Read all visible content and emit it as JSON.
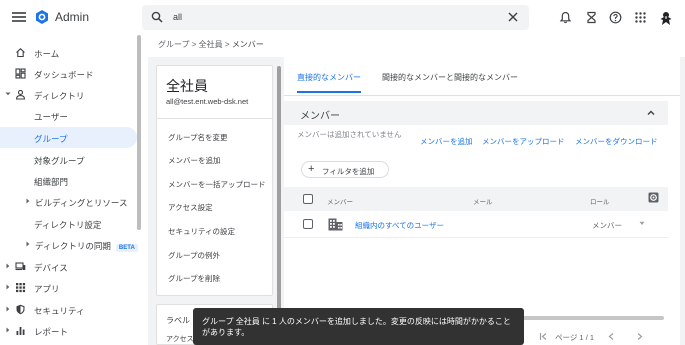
{
  "app": {
    "title": "Admin"
  },
  "search": {
    "value": "all"
  },
  "topbar": {
    "icons": [
      "notifications-icon",
      "hourglass-icon",
      "help-icon",
      "apps-grid-icon",
      "avatar"
    ]
  },
  "sidebar": {
    "items": [
      {
        "label": "ホーム",
        "icon": "home-icon"
      },
      {
        "label": "ダッシュボード",
        "icon": "dashboard-icon"
      },
      {
        "label": "ディレクトリ",
        "icon": "person-icon",
        "expanded": true
      },
      {
        "label": "ユーザー"
      },
      {
        "label": "グループ",
        "active": true
      },
      {
        "label": "対象グループ"
      },
      {
        "label": "組織部門"
      },
      {
        "label": "ビルディングとリソース"
      },
      {
        "label": "ディレクトリ設定"
      },
      {
        "label": "ディレクトリの同期",
        "badge": "BETA"
      },
      {
        "label": "デバイス",
        "icon": "devices-icon"
      },
      {
        "label": "アプリ",
        "icon": "apps-icon"
      },
      {
        "label": "セキュリティ",
        "icon": "shield-icon"
      },
      {
        "label": "レポート",
        "icon": "chart-icon"
      }
    ]
  },
  "breadcrumb": {
    "part1": "グループ",
    "sep": ">",
    "part2": "全社員",
    "part3": "メンバー"
  },
  "group": {
    "name": "全社員",
    "email": "all@test.ent.web-dsk.net",
    "menu": [
      "グループ名を変更",
      "メンバーを追加",
      "メンバーを一括アップロード",
      "アクセス設定",
      "セキュリティの設定",
      "グループの例外",
      "グループを削除"
    ],
    "card2_label": "ラベル",
    "card2_sub": "アクセス"
  },
  "tabs": {
    "direct": "直接的なメンバー",
    "indirect": "間接的なメンバーと間接的なメンバー"
  },
  "members": {
    "section_title": "メンバー",
    "empty_message": "メンバーは追加されていません",
    "actions": {
      "add": "メンバーを追加",
      "upload": "メンバーをアップロード",
      "download": "メンバーをダウンロード"
    },
    "filter_label": "フィルタを追加",
    "columns": {
      "member": "メンバー",
      "email": "メール",
      "role": "ロール"
    },
    "rows": [
      {
        "name": "組織内のすべてのユーザー",
        "email": "",
        "role": "メンバー"
      }
    ]
  },
  "pager": {
    "label": "ページ 1 / 1"
  },
  "toast": {
    "message": "グループ 全社員 に 1 人のメンバーを追加しました。変更の反映には時間がかかることがあります。"
  },
  "colors": {
    "accent": "#1a73e8",
    "toast_bg": "#323232"
  }
}
